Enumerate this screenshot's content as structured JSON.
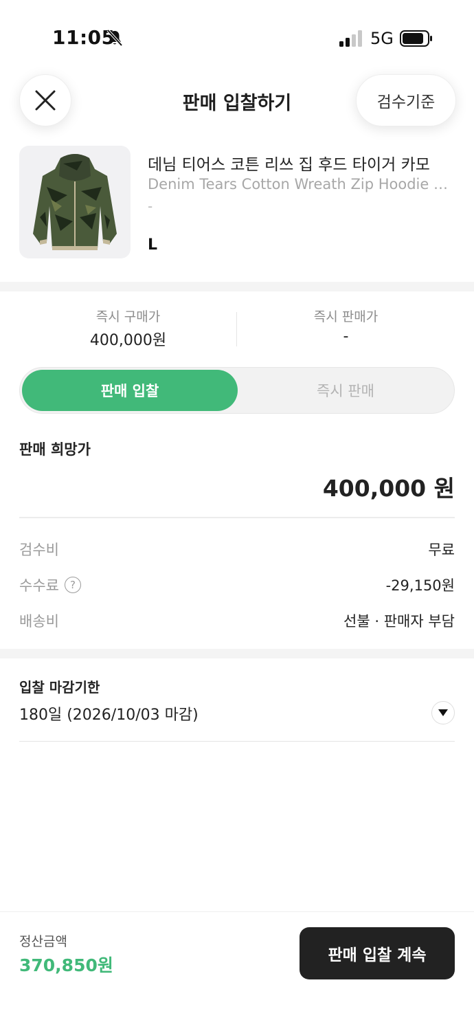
{
  "status_bar": {
    "time": "11:05",
    "network": "5G",
    "icons": [
      "bell-slash-icon",
      "signal-icon",
      "battery-icon"
    ]
  },
  "header": {
    "title": "판매 입찰하기",
    "close_icon": "close-icon",
    "criteria_label": "검수기준"
  },
  "product": {
    "name_ko": "데님 티어스 코튼 리쓰 집 후드 타이거 카모",
    "name_en": "Denim Tears Cotton Wreath Zip Hoodie Tiger Camo",
    "sub": "-",
    "size": "L"
  },
  "prices": {
    "instant_buy_label": "즉시 구매가",
    "instant_buy_value": "400,000원",
    "instant_sell_label": "즉시 판매가",
    "instant_sell_value": "-"
  },
  "toggle": {
    "active": "판매 입찰",
    "inactive": "즉시 판매"
  },
  "desired": {
    "label": "판매 희망가",
    "amount": "400,000 원"
  },
  "fees": [
    {
      "label": "검수비",
      "value": "무료"
    },
    {
      "label": "수수료",
      "value": "-29,150원",
      "help": "?"
    },
    {
      "label": "배송비",
      "value": "선불 · 판매자 부담"
    }
  ],
  "deadline": {
    "label": "입찰 마감기한",
    "value": "180일 (2026/10/03 마감)"
  },
  "bottom": {
    "settle_label": "정산금액",
    "settle_amount": "370,850원",
    "continue_label": "판매 입찰 계속"
  },
  "colors": {
    "accent_green": "#41b979",
    "button_dark": "#222222"
  }
}
